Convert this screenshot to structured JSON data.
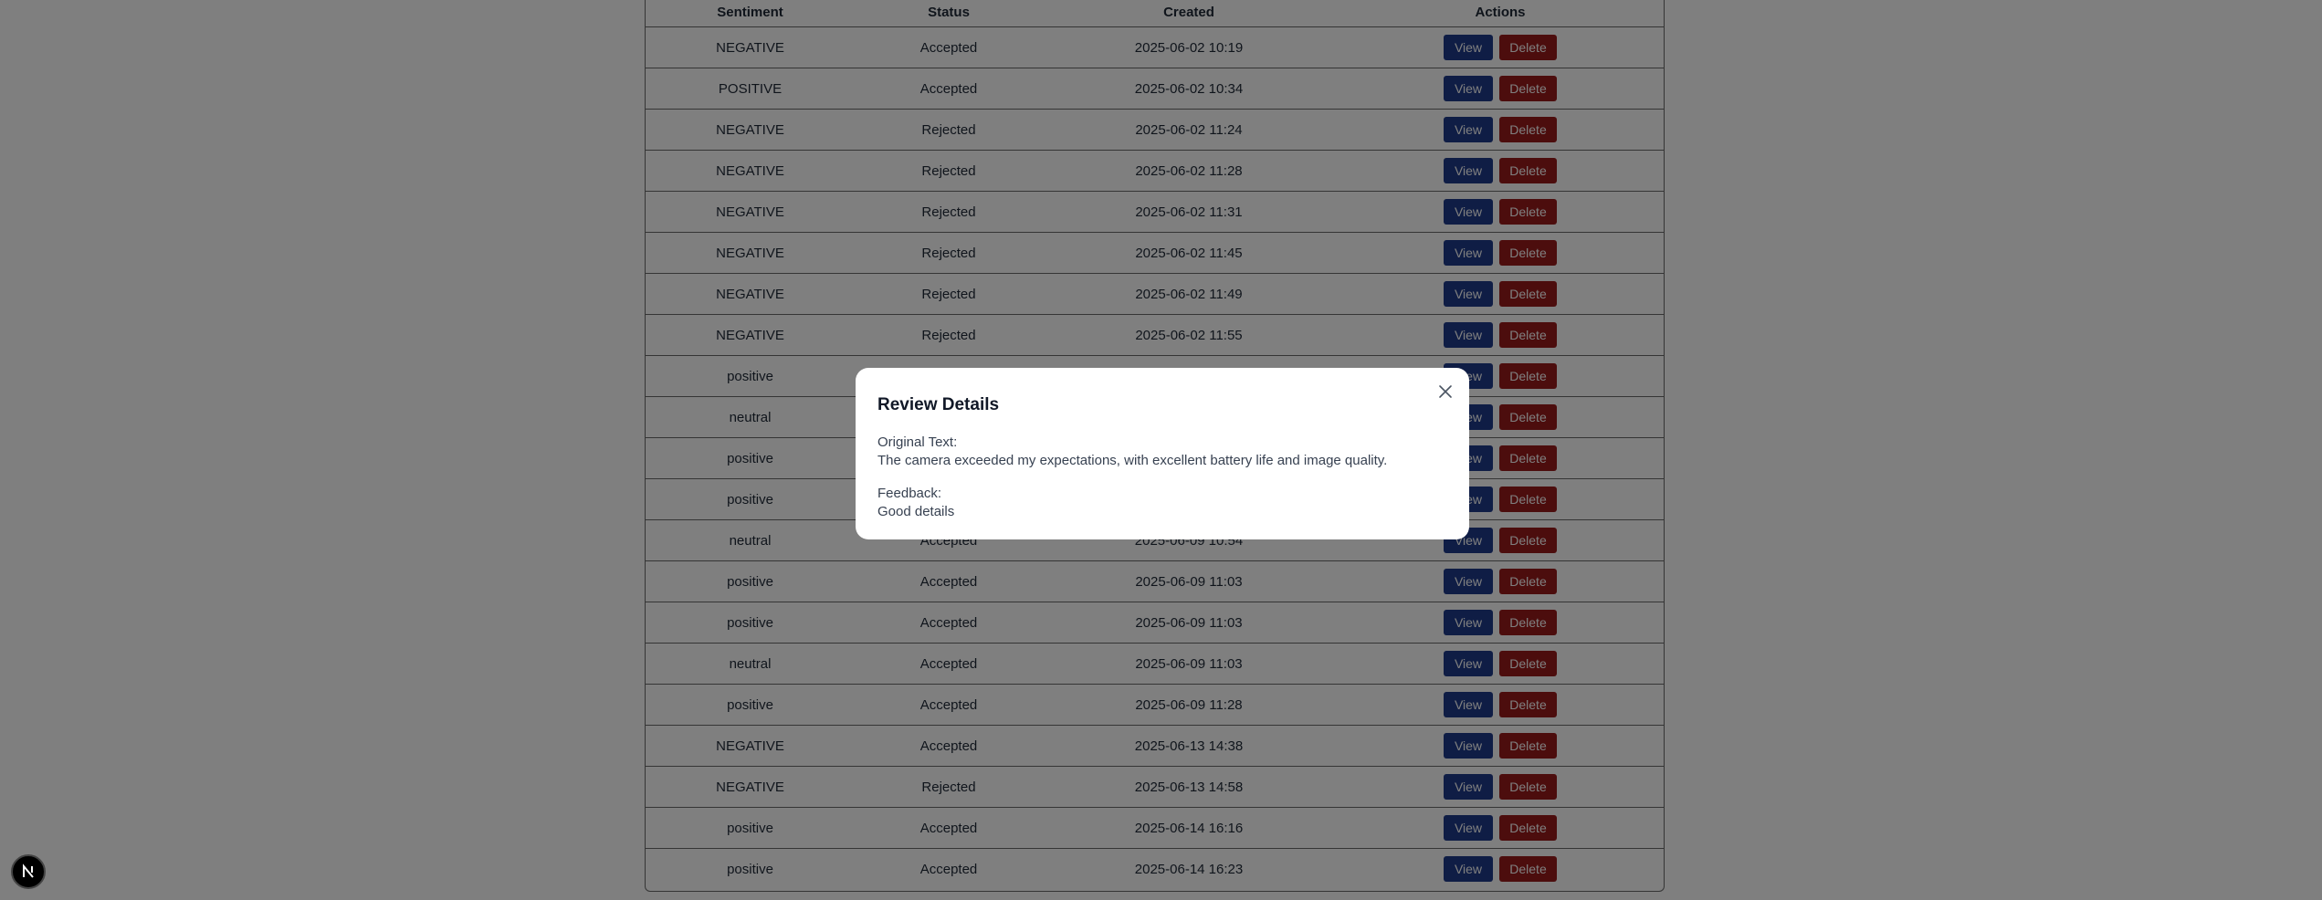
{
  "table": {
    "headers": [
      "Sentiment",
      "Status",
      "Created",
      "Actions"
    ],
    "view_label": "View",
    "delete_label": "Delete",
    "rows": [
      {
        "sentiment": "NEGATIVE",
        "status": "Accepted",
        "created": "2025-06-02 10:19"
      },
      {
        "sentiment": "POSITIVE",
        "status": "Accepted",
        "created": "2025-06-02 10:34"
      },
      {
        "sentiment": "NEGATIVE",
        "status": "Rejected",
        "created": "2025-06-02 11:24"
      },
      {
        "sentiment": "NEGATIVE",
        "status": "Rejected",
        "created": "2025-06-02 11:28"
      },
      {
        "sentiment": "NEGATIVE",
        "status": "Rejected",
        "created": "2025-06-02 11:31"
      },
      {
        "sentiment": "NEGATIVE",
        "status": "Rejected",
        "created": "2025-06-02 11:45"
      },
      {
        "sentiment": "NEGATIVE",
        "status": "Rejected",
        "created": "2025-06-02 11:49"
      },
      {
        "sentiment": "NEGATIVE",
        "status": "Rejected",
        "created": "2025-06-02 11:55"
      },
      {
        "sentiment": "positive",
        "status": "",
        "created": ""
      },
      {
        "sentiment": "neutral",
        "status": "",
        "created": ""
      },
      {
        "sentiment": "positive",
        "status": "",
        "created": ""
      },
      {
        "sentiment": "positive",
        "status": "",
        "created": ""
      },
      {
        "sentiment": "neutral",
        "status": "Accepted",
        "created": "2025-06-09 10:54"
      },
      {
        "sentiment": "positive",
        "status": "Accepted",
        "created": "2025-06-09 11:03"
      },
      {
        "sentiment": "positive",
        "status": "Accepted",
        "created": "2025-06-09 11:03"
      },
      {
        "sentiment": "neutral",
        "status": "Accepted",
        "created": "2025-06-09 11:03"
      },
      {
        "sentiment": "positive",
        "status": "Accepted",
        "created": "2025-06-09 11:28"
      },
      {
        "sentiment": "NEGATIVE",
        "status": "Accepted",
        "created": "2025-06-13 14:38"
      },
      {
        "sentiment": "NEGATIVE",
        "status": "Rejected",
        "created": "2025-06-13 14:58"
      },
      {
        "sentiment": "positive",
        "status": "Accepted",
        "created": "2025-06-14 16:16"
      },
      {
        "sentiment": "positive",
        "status": "Accepted",
        "created": "2025-06-14 16:23"
      }
    ]
  },
  "modal": {
    "title": "Review Details",
    "original_text_label": "Original Text:",
    "original_text": "The camera exceeded my expectations, with excellent battery life and image quality.",
    "feedback_label": "Feedback:",
    "feedback": "Good details",
    "close_icon": "close-icon"
  },
  "badge": {
    "letter": "N",
    "icon": "nextjs-logo-icon"
  },
  "colors": {
    "view": "#1e3a8a",
    "delete": "#991b1b",
    "overlay": "rgba(0,0,0,0.5)"
  }
}
